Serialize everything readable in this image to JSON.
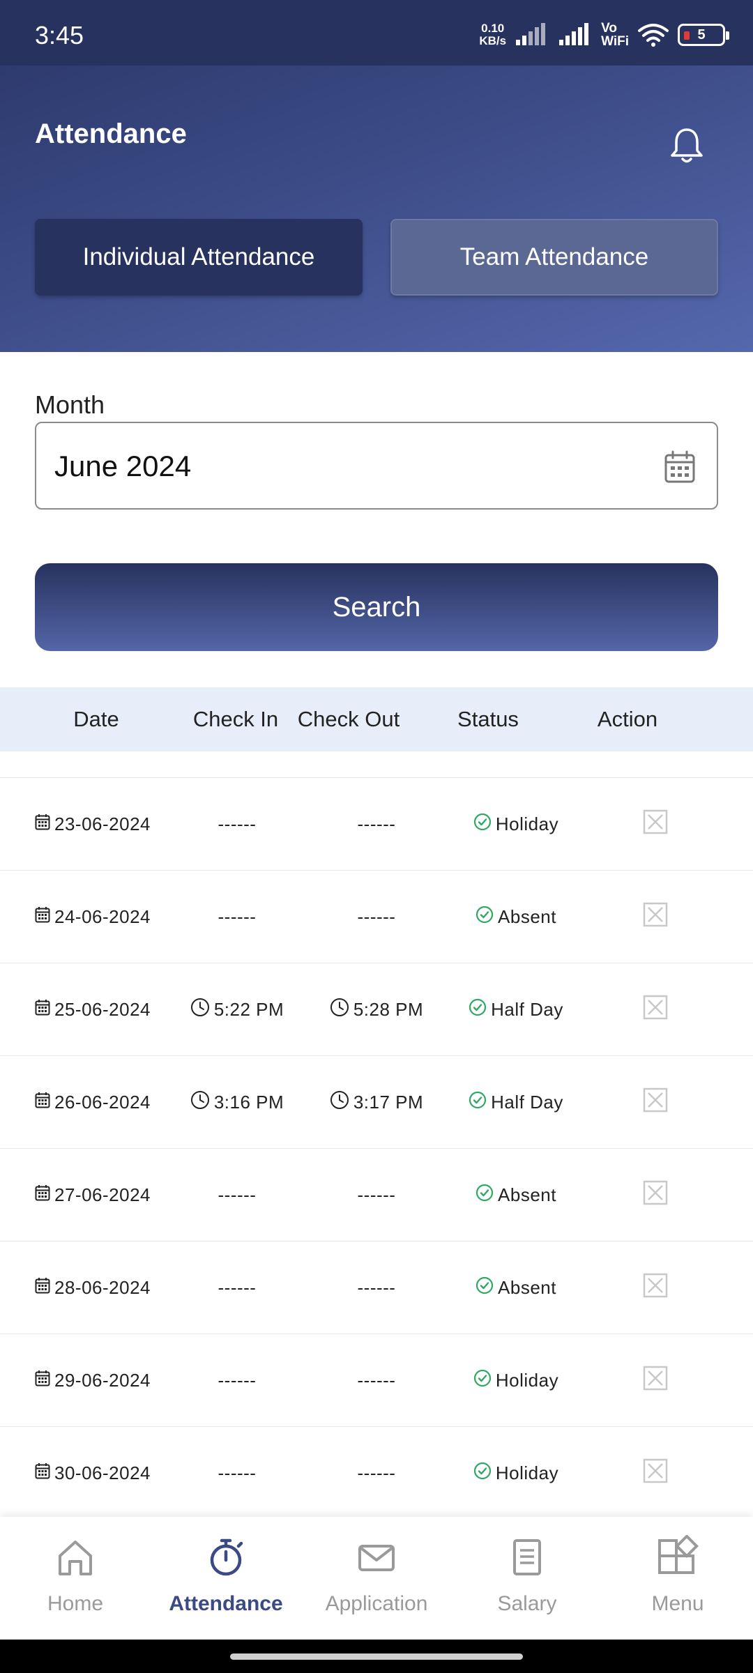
{
  "status_bar": {
    "time": "3:45",
    "net_speed_value": "0.10",
    "net_speed_unit": "KB/s",
    "vowifi_top": "Vo",
    "vowifi_bottom": "WiFi",
    "battery": "5"
  },
  "header": {
    "title": "Attendance",
    "tabs": [
      "Individual Attendance",
      "Team Attendance"
    ]
  },
  "filter": {
    "month_label": "Month",
    "month_value": "June 2024",
    "search_label": "Search"
  },
  "table": {
    "columns": [
      "Date",
      "Check In",
      "Check Out",
      "Status",
      "Action"
    ],
    "rows": [
      {
        "date": "23-06-2024",
        "check_in": "------",
        "check_out": "------",
        "status": "Holiday"
      },
      {
        "date": "24-06-2024",
        "check_in": "------",
        "check_out": "------",
        "status": "Absent"
      },
      {
        "date": "25-06-2024",
        "check_in": "5:22 PM",
        "check_out": "5:28 PM",
        "status": "Half Day"
      },
      {
        "date": "26-06-2024",
        "check_in": "3:16 PM",
        "check_out": "3:17 PM",
        "status": "Half Day"
      },
      {
        "date": "27-06-2024",
        "check_in": "------",
        "check_out": "------",
        "status": "Absent"
      },
      {
        "date": "28-06-2024",
        "check_in": "------",
        "check_out": "------",
        "status": "Absent"
      },
      {
        "date": "29-06-2024",
        "check_in": "------",
        "check_out": "------",
        "status": "Holiday"
      },
      {
        "date": "30-06-2024",
        "check_in": "------",
        "check_out": "------",
        "status": "Holiday"
      }
    ]
  },
  "bottom_nav": {
    "items": [
      {
        "label": "Home",
        "icon": "home-icon"
      },
      {
        "label": "Attendance",
        "icon": "stopwatch-icon"
      },
      {
        "label": "Application",
        "icon": "mail-icon"
      },
      {
        "label": "Salary",
        "icon": "document-icon"
      },
      {
        "label": "Menu",
        "icon": "grid-menu-icon"
      }
    ],
    "active": "Attendance"
  },
  "colors": {
    "primary_dark": "#27325e",
    "primary_light": "#5466a8",
    "status_green": "#2fa865",
    "table_header_bg": "#e8eef9"
  }
}
